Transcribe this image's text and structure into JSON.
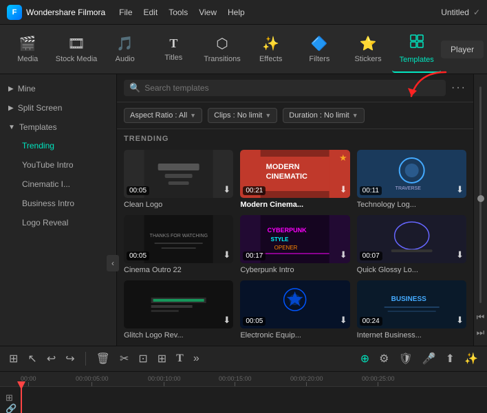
{
  "app": {
    "name": "Wondershare Filmora",
    "title": "Untitled",
    "logo_text": "F"
  },
  "menu": {
    "items": [
      "File",
      "Edit",
      "Tools",
      "View",
      "Help"
    ]
  },
  "toolbar": {
    "tools": [
      {
        "id": "media",
        "label": "Media",
        "icon": "🎬"
      },
      {
        "id": "stock_media",
        "label": "Stock Media",
        "icon": "🎞"
      },
      {
        "id": "audio",
        "label": "Audio",
        "icon": "🎵"
      },
      {
        "id": "titles",
        "label": "Titles",
        "icon": "T"
      },
      {
        "id": "transitions",
        "label": "Transitions",
        "icon": "⬡"
      },
      {
        "id": "effects",
        "label": "Effects",
        "icon": "✨"
      },
      {
        "id": "filters",
        "label": "Filters",
        "icon": "🔷"
      },
      {
        "id": "stickers",
        "label": "Stickers",
        "icon": "⭐"
      },
      {
        "id": "templates",
        "label": "Templates",
        "icon": "⊞"
      }
    ],
    "active": "templates",
    "player_label": "Player"
  },
  "sidebar": {
    "sections": [
      {
        "id": "mine",
        "label": "Mine",
        "expanded": false
      },
      {
        "id": "split_screen",
        "label": "Split Screen",
        "expanded": false
      },
      {
        "id": "templates",
        "label": "Templates",
        "expanded": true,
        "children": [
          {
            "id": "trending",
            "label": "Trending",
            "active": true
          },
          {
            "id": "youtube_intro",
            "label": "YouTube Intro",
            "active": false
          },
          {
            "id": "cinematic",
            "label": "Cinematic I...",
            "active": false
          },
          {
            "id": "business_intro",
            "label": "Business Intro",
            "active": false
          },
          {
            "id": "logo_reveal",
            "label": "Logo Reveal",
            "active": false
          }
        ]
      }
    ]
  },
  "search": {
    "placeholder": "Search templates"
  },
  "filters": {
    "aspect_ratio": {
      "label": "Aspect Ratio : All"
    },
    "clips": {
      "label": "Clips : No limit"
    },
    "duration": {
      "label": "Duration : No limit"
    }
  },
  "section": {
    "trending_label": "TRENDING"
  },
  "templates": [
    {
      "id": 1,
      "name": "Clean Logo",
      "duration": "00:05",
      "bold": false,
      "star": false,
      "bg": "#222",
      "thumb_style": "dark_text",
      "thumb_color": "#2a2a2a"
    },
    {
      "id": 2,
      "name": "Modern Cinema...",
      "duration": "00:21",
      "bold": true,
      "star": true,
      "bg": "#c0392b",
      "thumb_style": "red_modern",
      "thumb_color": "#c0392b"
    },
    {
      "id": 3,
      "name": "Technology Log...",
      "duration": "00:11",
      "bold": false,
      "star": false,
      "bg": "#1a2a3a",
      "thumb_style": "blue_tech",
      "thumb_color": "#1a3a5c"
    },
    {
      "id": 4,
      "name": "Cinema Outro 22",
      "duration": "00:05",
      "bold": false,
      "star": false,
      "bg": "#1a1a1a",
      "thumb_style": "dark_thanks",
      "thumb_color": "#1e2020"
    },
    {
      "id": 5,
      "name": "Cyberpunk Intro",
      "duration": "00:17",
      "bold": false,
      "star": false,
      "bg": "#1a0a2a",
      "thumb_style": "purple_cyber",
      "thumb_color": "#220a33"
    },
    {
      "id": 6,
      "name": "Quick Glossy Lo...",
      "duration": "00:07",
      "bold": false,
      "star": false,
      "bg": "#1a1a2a",
      "thumb_style": "dark_glossy",
      "thumb_color": "#1a1a2a"
    },
    {
      "id": 7,
      "name": "Glitch Logo Rev...",
      "duration": "",
      "bold": false,
      "star": false,
      "bg": "#111",
      "thumb_style": "glitch",
      "thumb_color": "#111"
    },
    {
      "id": 8,
      "name": "Electronic Equip...",
      "duration": "00:05",
      "bold": false,
      "star": false,
      "bg": "#050a1a",
      "thumb_style": "blue_elec",
      "thumb_color": "#061228"
    },
    {
      "id": 9,
      "name": "Internet Business...",
      "duration": "00:24",
      "bold": false,
      "star": false,
      "bg": "#0a1520",
      "thumb_style": "business_blue",
      "thumb_color": "#0a1a2a"
    }
  ],
  "timeline": {
    "marks": [
      {
        "time": "00:00",
        "offset": 30
      },
      {
        "time": "00:00:05:00",
        "offset": 110
      },
      {
        "time": "00:00:10:00",
        "offset": 215
      },
      {
        "time": "00:00:15:00",
        "offset": 318
      },
      {
        "time": "00:00:20:00",
        "offset": 422
      },
      {
        "time": "00:00:25:00",
        "offset": 526
      }
    ]
  },
  "bottom_toolbar": {
    "icons": [
      "⊞",
      "↖",
      "↩",
      "↪",
      "🗑",
      "✂",
      "⊡",
      "⊞",
      "T",
      "»"
    ]
  }
}
